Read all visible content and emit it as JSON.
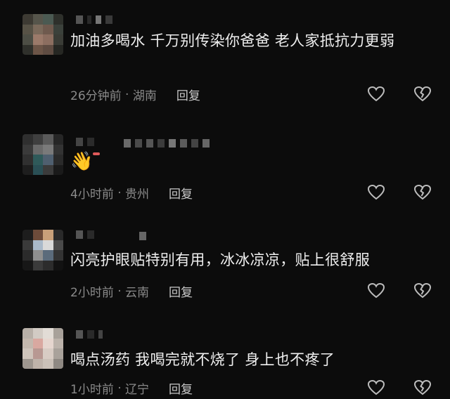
{
  "comments": [
    {
      "text": "加油多喝水 千万别传染你爸爸 老人家抵抗力更弱",
      "time": "26分钟前",
      "location": "湖南",
      "reply": "回复"
    },
    {
      "text": "👋",
      "time": "4小时前",
      "location": "贵州",
      "reply": "回复"
    },
    {
      "text": "闪亮护眼贴特别有用，冰冰凉凉，贴上很舒服",
      "time": "2小时前",
      "location": "云南",
      "reply": "回复"
    },
    {
      "text": "喝点汤药 我喝完就不烧了 身上也不疼了",
      "time": "1小时前",
      "location": "辽宁",
      "reply": "回复"
    }
  ],
  "icons": {
    "like": "heart-outline-icon",
    "dislike": "broken-heart-icon"
  },
  "colors": {
    "background": "#0c0c0c",
    "meta_text": "#8a8a8a",
    "reply_text": "#c9c9c9"
  }
}
